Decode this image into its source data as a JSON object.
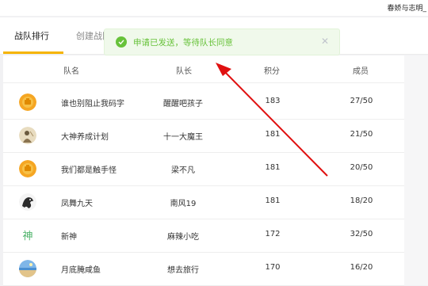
{
  "header": {
    "user_name": "春娇与志明_"
  },
  "tabs": [
    {
      "label": "战队排行",
      "active": true
    },
    {
      "label": "创建战队",
      "active": false
    }
  ],
  "toast": {
    "message": "申请已发送，等待队长同意",
    "type": "success",
    "color": "#67c23a",
    "icon": "check-circle-icon",
    "close_icon": "close-icon"
  },
  "table": {
    "columns": [
      "队名",
      "队长",
      "积分",
      "成员"
    ],
    "rows": [
      {
        "avatar": "orange-badge-avatar",
        "team": "谁也别阻止我码字",
        "leader": "醒醒吧孩子",
        "score": "183",
        "members": "27/50"
      },
      {
        "avatar": "illustration-avatar",
        "team": "大神养成计划",
        "leader": "十一大魔王",
        "score": "181",
        "members": "21/50"
      },
      {
        "avatar": "orange-badge-avatar",
        "team": "我们都是触手怪",
        "leader": "梁不凡",
        "score": "181",
        "members": "20/50"
      },
      {
        "avatar": "dark-horse-avatar",
        "team": "凤舞九天",
        "leader": "南风19",
        "score": "181",
        "members": "18/20"
      },
      {
        "avatar": "shen-character-avatar",
        "avatar_text": "神",
        "team": "新神",
        "leader": "麻辣小吃",
        "score": "172",
        "members": "32/50"
      },
      {
        "avatar": "beach-photo-avatar",
        "team": "月底腌咸鱼",
        "leader": "想去旅行",
        "score": "170",
        "members": "16/20"
      }
    ]
  },
  "annotation": {
    "type": "red-arrow",
    "color": "#e01010"
  }
}
